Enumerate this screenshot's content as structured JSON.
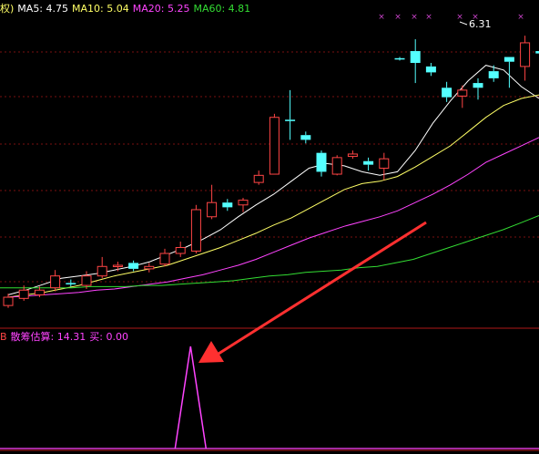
{
  "main_legend": {
    "prefix": "权)",
    "ma5": "MA5: 4.75",
    "ma10": "MA10: 5.04",
    "ma20": "MA20: 5.25",
    "ma60": "MA60: 4.81"
  },
  "indicator_legend": {
    "prefix": "B",
    "label": "散筹估算: 14.31",
    "buy": "买: 0.00"
  },
  "price_label": "6.31",
  "colors": {
    "up": "#ff4545",
    "down": "#54ffff",
    "ma5": "#ffffff",
    "ma10": "#ffff66",
    "ma20": "#ff44ff",
    "ma60": "#33dd33",
    "grid": "#7a1010",
    "arrow": "#ff3030",
    "indicator": "#ff44ff",
    "marker": "#cc44cc"
  },
  "chart_data": {
    "type": "candlestick",
    "series": [
      {
        "name": "MA5",
        "values": [
          4.12,
          4.16,
          4.21,
          4.26,
          4.28,
          4.3,
          4.33,
          4.36,
          4.4,
          4.46,
          4.52,
          4.59,
          4.67,
          4.78,
          4.88,
          4.97,
          5.08,
          5.19,
          5.23,
          5.21,
          5.16,
          5.13,
          5.16,
          5.34,
          5.57,
          5.76,
          5.93,
          6.06,
          6.02,
          5.88,
          5.78
        ]
      },
      {
        "name": "MA10",
        "values": [
          4.1,
          4.12,
          4.14,
          4.17,
          4.2,
          4.24,
          4.28,
          4.31,
          4.34,
          4.37,
          4.42,
          4.47,
          4.52,
          4.58,
          4.64,
          4.71,
          4.77,
          4.85,
          4.93,
          5.01,
          5.06,
          5.08,
          5.12,
          5.2,
          5.29,
          5.38,
          5.5,
          5.62,
          5.72,
          5.78,
          5.81
        ]
      },
      {
        "name": "MA20",
        "values": [
          4.1,
          4.11,
          4.12,
          4.13,
          4.14,
          4.16,
          4.17,
          4.19,
          4.21,
          4.23,
          4.26,
          4.29,
          4.33,
          4.37,
          4.42,
          4.48,
          4.54,
          4.6,
          4.65,
          4.7,
          4.74,
          4.78,
          4.83,
          4.9,
          4.97,
          5.05,
          5.14,
          5.24,
          5.31,
          5.38,
          5.45
        ]
      },
      {
        "name": "MA60",
        "values": [
          4.18,
          4.18,
          4.18,
          4.18,
          4.18,
          4.19,
          4.19,
          4.19,
          4.2,
          4.2,
          4.21,
          4.22,
          4.23,
          4.24,
          4.26,
          4.28,
          4.29,
          4.31,
          4.32,
          4.33,
          4.35,
          4.36,
          4.39,
          4.42,
          4.47,
          4.52,
          4.57,
          4.62,
          4.67,
          4.73,
          4.79
        ]
      }
    ],
    "candles": [
      {
        "o": 4.03,
        "c": 4.1,
        "h": 4.13,
        "l": 4.01
      },
      {
        "o": 4.09,
        "c": 4.16,
        "h": 4.2,
        "l": 4.07
      },
      {
        "o": 4.12,
        "c": 4.16,
        "h": 4.19,
        "l": 4.1
      },
      {
        "o": 4.18,
        "c": 4.28,
        "h": 4.33,
        "l": 4.15
      },
      {
        "o": 4.22,
        "c": 4.21,
        "h": 4.25,
        "l": 4.19
      },
      {
        "o": 4.2,
        "c": 4.28,
        "h": 4.32,
        "l": 4.17
      },
      {
        "o": 4.28,
        "c": 4.36,
        "h": 4.44,
        "l": 4.26
      },
      {
        "o": 4.36,
        "c": 4.37,
        "h": 4.4,
        "l": 4.32
      },
      {
        "o": 4.39,
        "c": 4.34,
        "h": 4.41,
        "l": 4.32
      },
      {
        "o": 4.34,
        "c": 4.36,
        "h": 4.39,
        "l": 4.31
      },
      {
        "o": 4.38,
        "c": 4.47,
        "h": 4.51,
        "l": 4.36
      },
      {
        "o": 4.47,
        "c": 4.52,
        "h": 4.57,
        "l": 4.44
      },
      {
        "o": 4.49,
        "c": 4.84,
        "h": 4.88,
        "l": 4.47
      },
      {
        "o": 4.78,
        "c": 4.9,
        "h": 5.05,
        "l": 4.76
      },
      {
        "o": 4.9,
        "c": 4.86,
        "h": 4.93,
        "l": 4.83
      },
      {
        "o": 4.88,
        "c": 4.92,
        "h": 4.94,
        "l": 4.82
      },
      {
        "o": 5.07,
        "c": 5.13,
        "h": 5.17,
        "l": 5.05
      },
      {
        "o": 5.14,
        "c": 5.62,
        "h": 5.65,
        "l": 5.14
      },
      {
        "o": 5.6,
        "c": 5.59,
        "h": 5.85,
        "l": 5.43
      },
      {
        "o": 5.47,
        "c": 5.43,
        "h": 5.5,
        "l": 5.4
      },
      {
        "o": 5.32,
        "c": 5.16,
        "h": 5.34,
        "l": 5.12
      },
      {
        "o": 5.14,
        "c": 5.28,
        "h": 5.3,
        "l": 5.13
      },
      {
        "o": 5.29,
        "c": 5.31,
        "h": 5.34,
        "l": 5.27
      },
      {
        "o": 5.25,
        "c": 5.22,
        "h": 5.28,
        "l": 5.17
      },
      {
        "o": 5.19,
        "c": 5.27,
        "h": 5.32,
        "l": 5.09
      },
      {
        "o": 6.12,
        "c": 6.11,
        "h": 6.13,
        "l": 6.1
      },
      {
        "o": 6.18,
        "c": 6.08,
        "h": 6.28,
        "l": 5.91
      },
      {
        "o": 6.05,
        "c": 6.0,
        "h": 6.08,
        "l": 5.97
      },
      {
        "o": 5.87,
        "c": 5.79,
        "h": 5.92,
        "l": 5.75
      },
      {
        "o": 5.8,
        "c": 5.85,
        "h": 5.89,
        "l": 5.7
      },
      {
        "o": 5.91,
        "c": 5.87,
        "h": 5.95,
        "l": 5.77
      }
    ],
    "extra_candles": [
      {
        "o": 6.01,
        "c": 5.95,
        "h": 6.06,
        "l": 5.92
      },
      {
        "o": 6.13,
        "c": 6.09,
        "h": 6.13,
        "l": 5.87
      },
      {
        "o": 6.05,
        "c": 6.25,
        "h": 6.31,
        "l": 5.93
      },
      {
        "o": 6.18,
        "c": 6.16,
        "h": 6.22,
        "l": 5.91
      },
      {
        "o": 6.0,
        "c": 5.95,
        "h": 6.05,
        "l": 5.86
      },
      {
        "o": 5.92,
        "c": 5.84,
        "h": 5.98,
        "l": 5.81
      }
    ],
    "indicator": {
      "name": "散筹估算",
      "values": [
        0,
        0,
        0,
        0,
        0,
        0,
        0,
        0,
        0,
        0,
        0,
        0,
        0,
        0,
        0,
        0,
        0,
        0,
        0,
        0,
        0,
        0,
        0,
        0,
        0,
        0,
        0,
        0,
        0,
        0,
        0,
        0,
        0,
        0,
        0,
        14.31,
        0,
        0,
        0,
        0,
        0,
        0,
        0,
        0,
        0,
        0,
        0,
        0,
        0,
        0,
        0,
        0,
        0,
        0,
        0,
        0,
        0,
        0,
        0,
        0,
        0,
        0,
        0,
        0,
        0,
        0,
        0,
        0,
        0,
        0,
        0,
        0,
        0,
        0,
        0,
        0,
        0,
        0,
        0,
        0,
        0,
        0,
        0,
        0,
        0,
        0,
        0,
        0,
        0,
        0,
        0,
        0,
        0,
        0,
        0,
        0,
        0,
        0,
        0,
        0
      ]
    },
    "high_label": "6.31",
    "markers_count": 8
  }
}
